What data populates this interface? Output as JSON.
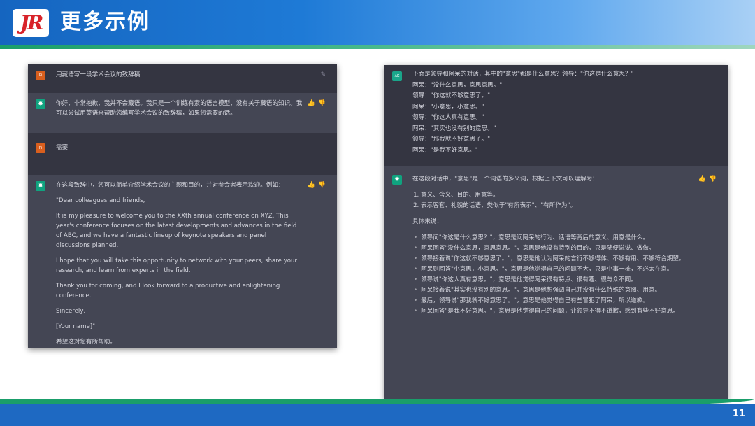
{
  "header": {
    "title": "更多示例",
    "logo_text": "JR"
  },
  "page_number": "11",
  "left": {
    "q1": "用藏语写一段学术会议的致辞稿",
    "a1": "你好，非常抱歉，我并不会藏语。我只是一个训练有素的语言模型，没有关于藏语的知识。我可以尝试用英语来帮助您编写学术会议的致辞稿，如果您需要的话。",
    "q2": "需要",
    "a2": [
      "在这段致辞中，您可以简单介绍学术会议的主题和目的，并对参会者表示欢迎。例如：",
      "\"Dear colleagues and friends,",
      "It is my pleasure to welcome you to the XXth annual conference on XYZ. This year's conference focuses on the latest developments and advances in the field of ABC, and we have a fantastic lineup of keynote speakers and panel discussions planned.",
      "I hope that you will take this opportunity to network with your peers, share your research, and learn from experts in the field.",
      "Thank you for coming, and I look forward to a productive and enlightening conference.",
      "Sincerely,",
      "[Your name]\"",
      "希望这对您有所帮助。"
    ]
  },
  "right": {
    "q": [
      "下面是领导和阿呆的对话，其中的\"意思\"都是什么意思？领导：\"你这是什么意思？\"",
      "阿呆：\"没什么意思，意思意思。\"",
      "领导：\"你这就不够意思了。\"",
      "阿呆：\"小意思，小意思。\"",
      "领导：\"你这人真有意思。\"",
      "阿呆：\"其实也没有别的意思。\"",
      "领导：\"那我就不好意思了。\"",
      "阿呆：\"是我不好意思。\""
    ],
    "a_intro": "在这段对话中，\"意思\"是一个词语的多义词，根据上下文可以理解为：",
    "a_list": [
      "意义、含义、目的、用意等。",
      "表示客套、礼貌的话语，类似于\"有所表示\"、\"有所作为\"。"
    ],
    "a_mid": "具体来说：",
    "a_bullets": [
      "领导问\"你这是什么意思？\"，意思是问阿呆的行为、话语等背后的意义、用意是什么。",
      "阿呆回答\"没什么意思，意思意思。\"，意思是他没有特别的目的，只是随便说说、做做。",
      "领导接着说\"你这就不够意思了。\"，意思是他认为阿呆的言行不够得体、不够有用、不够符合期望。",
      "阿呆则回答\"小意思，小意思。\"，意思是他觉得自己的问题不大，只是小事一桩，不必太在意。",
      "领导说\"你这人真有意思。\"，意思是他觉得阿呆很有特点、很有趣、很与众不同。",
      "阿呆接着说\"其实也没有别的意思。\"，意思是他想强调自己并没有什么特殊的意图、用意。",
      "最后，领导说\"那我就不好意思了。\"，意思是他觉得自己有些冒犯了阿呆，所以道歉。",
      "阿呆回答\"是我不好意思。\"，意思是他觉得自己的问题，让领导不得不道歉，感到有些不好意思。"
    ]
  }
}
